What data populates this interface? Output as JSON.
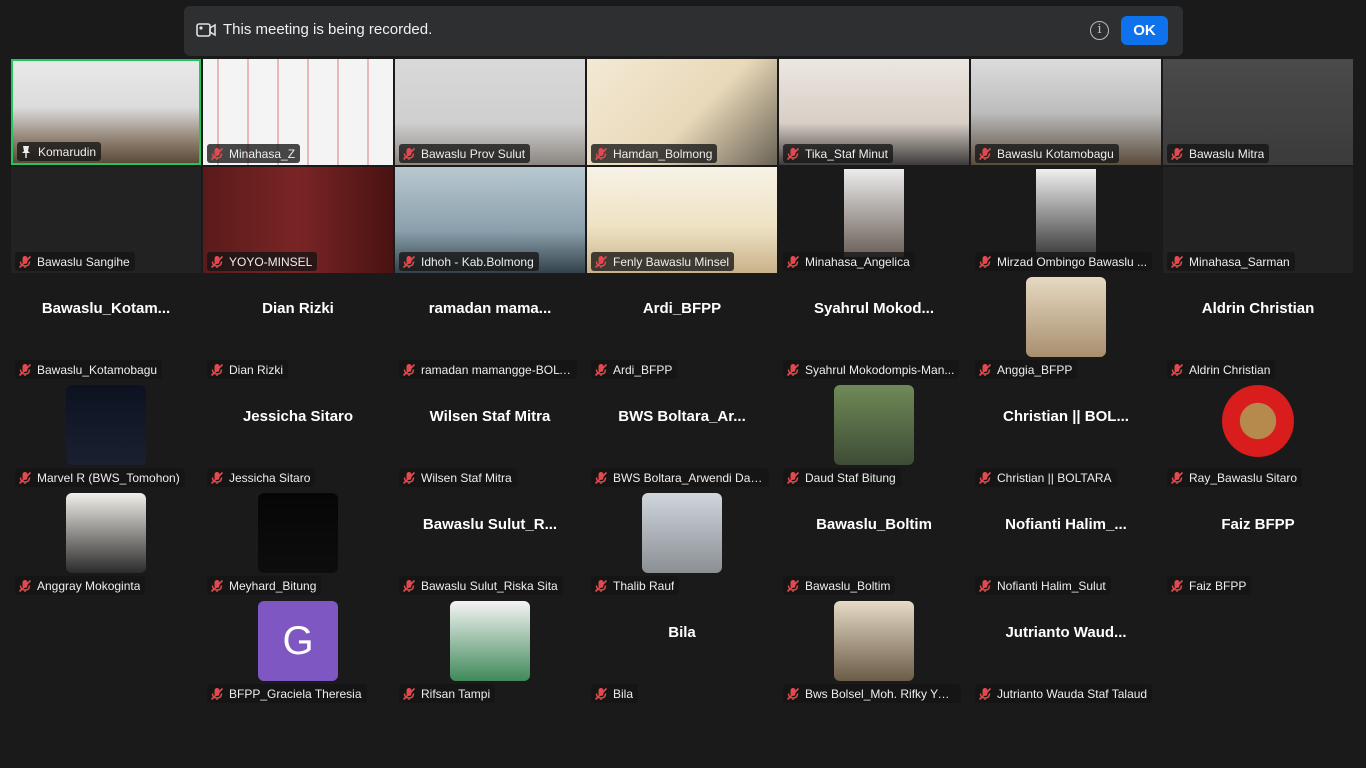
{
  "banner": {
    "text": "This meeting is being recorded.",
    "ok_label": "OK",
    "info_glyph": "i",
    "icons": [
      "video-record-icon",
      "info-icon"
    ]
  },
  "colors": {
    "background": "#1a1a1a",
    "ok_button": "#0e72ed",
    "active_speaker_border": "#22c55e",
    "muted_mic": "#e5484d"
  },
  "participants": [
    {
      "label": "Komarudin",
      "view": "video",
      "active": true,
      "pinned": true
    },
    {
      "label": "Minahasa_Z",
      "view": "video"
    },
    {
      "label": "Bawaslu Prov Sulut",
      "view": "video"
    },
    {
      "label": "Hamdan_Bolmong",
      "view": "video"
    },
    {
      "label": "Tika_Staf Minut",
      "view": "video"
    },
    {
      "label": "Bawaslu Kotamobagu",
      "view": "video"
    },
    {
      "label": "Bawaslu Mitra",
      "view": "video"
    },
    {
      "label": "Bawaslu Sangihe",
      "view": "video-off"
    },
    {
      "label": "YOYO-MINSEL",
      "view": "video"
    },
    {
      "label": "Idhoh - Kab.Bolmong",
      "view": "video"
    },
    {
      "label": "Fenly Bawaslu Minsel",
      "view": "video"
    },
    {
      "label": "Minahasa_Angelica",
      "view": "video-small"
    },
    {
      "label": "Mirzad Ombingo Bawaslu ...",
      "view": "video-small"
    },
    {
      "label": "Minahasa_Sarman",
      "view": "video-off"
    },
    {
      "label": "Bawaslu_Kotamobagu",
      "view": "name",
      "display": "Bawaslu_Kotam..."
    },
    {
      "label": "Dian Rizki",
      "view": "name",
      "display": "Dian Rizki"
    },
    {
      "label": "ramadan mamangge-BOLT...",
      "view": "name",
      "display": "ramadan mama..."
    },
    {
      "label": "Ardi_BFPP",
      "view": "name",
      "display": "Ardi_BFPP"
    },
    {
      "label": "Syahrul Mokodompis-Man...",
      "view": "name",
      "display": "Syahrul Mokod..."
    },
    {
      "label": "Anggia_BFPP",
      "view": "avatar"
    },
    {
      "label": "Aldrin Christian",
      "view": "name",
      "display": "Aldrin Christian"
    },
    {
      "label": "Marvel R (BWS_Tomohon)",
      "view": "avatar"
    },
    {
      "label": "Jessicha Sitaro",
      "view": "name",
      "display": "Jessicha Sitaro"
    },
    {
      "label": "Wilsen Staf Mitra",
      "view": "name",
      "display": "Wilsen Staf Mitra"
    },
    {
      "label": "BWS Boltara_Arwendi Datu...",
      "view": "name",
      "display": "BWS Boltara_Ar..."
    },
    {
      "label": "Daud Staf Bitung",
      "view": "avatar"
    },
    {
      "label": "Christian || BOLTARA",
      "view": "name",
      "display": "Christian || BOL..."
    },
    {
      "label": "Ray_Bawaslu Sitaro",
      "view": "avatar"
    },
    {
      "label": "Anggray Mokoginta",
      "view": "avatar"
    },
    {
      "label": "Meyhard_Bitung",
      "view": "avatar"
    },
    {
      "label": "Bawaslu Sulut_Riska Sita",
      "view": "name",
      "display": "Bawaslu Sulut_R..."
    },
    {
      "label": "Thalib Rauf",
      "view": "avatar"
    },
    {
      "label": "Bawaslu_Boltim",
      "view": "name",
      "display": "Bawaslu_Boltim"
    },
    {
      "label": "Nofianti Halim_Sulut",
      "view": "name",
      "display": "Nofianti Halim_..."
    },
    {
      "label": "Faiz BFPP",
      "view": "name",
      "display": "Faiz BFPP"
    },
    {
      "label": "BFPP_Graciela Theresia",
      "view": "letter",
      "letter": "G"
    },
    {
      "label": "Rifsan Tampi",
      "view": "avatar"
    },
    {
      "label": "Bila",
      "view": "name",
      "display": "Bila"
    },
    {
      "label": "Bws Bolsel_Moh. Rifky Yunus",
      "view": "avatar"
    },
    {
      "label": "Jutrianto Wauda Staf Talaud",
      "view": "name",
      "display": "Jutrianto Waud..."
    }
  ]
}
